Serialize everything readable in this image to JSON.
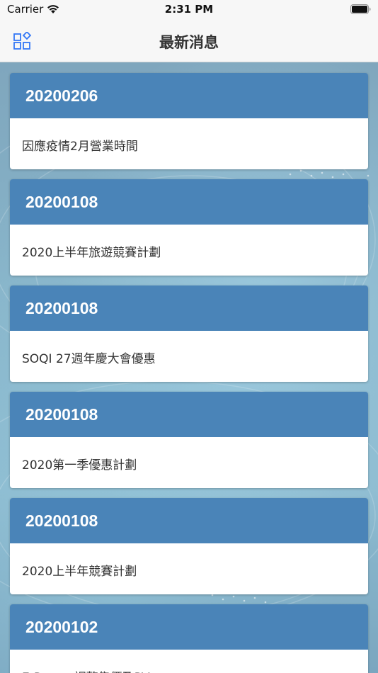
{
  "status_bar": {
    "carrier": "Carrier",
    "time": "2:31 PM",
    "wifi_icon": "wifi-icon",
    "battery_icon": "battery-icon"
  },
  "nav": {
    "title": "最新消息",
    "menu_icon": "grid-menu-icon"
  },
  "colors": {
    "card_header": "#4a84b8",
    "card_body": "#ffffff",
    "nav_background": "#f7f7f7",
    "accent": "#3478f6"
  },
  "news": [
    {
      "date": "20200206",
      "title": "因應疫情2月營業時間"
    },
    {
      "date": "20200108",
      "title": "2020上半年旅遊競賽計劃"
    },
    {
      "date": "20200108",
      "title": "SOQI 27週年慶大會優惠"
    },
    {
      "date": "20200108",
      "title": "2020第一季優惠計劃"
    },
    {
      "date": "20200108",
      "title": "2020上半年競賽計劃"
    },
    {
      "date": "20200102",
      "title": "E-Power 調整售價及PV"
    }
  ]
}
